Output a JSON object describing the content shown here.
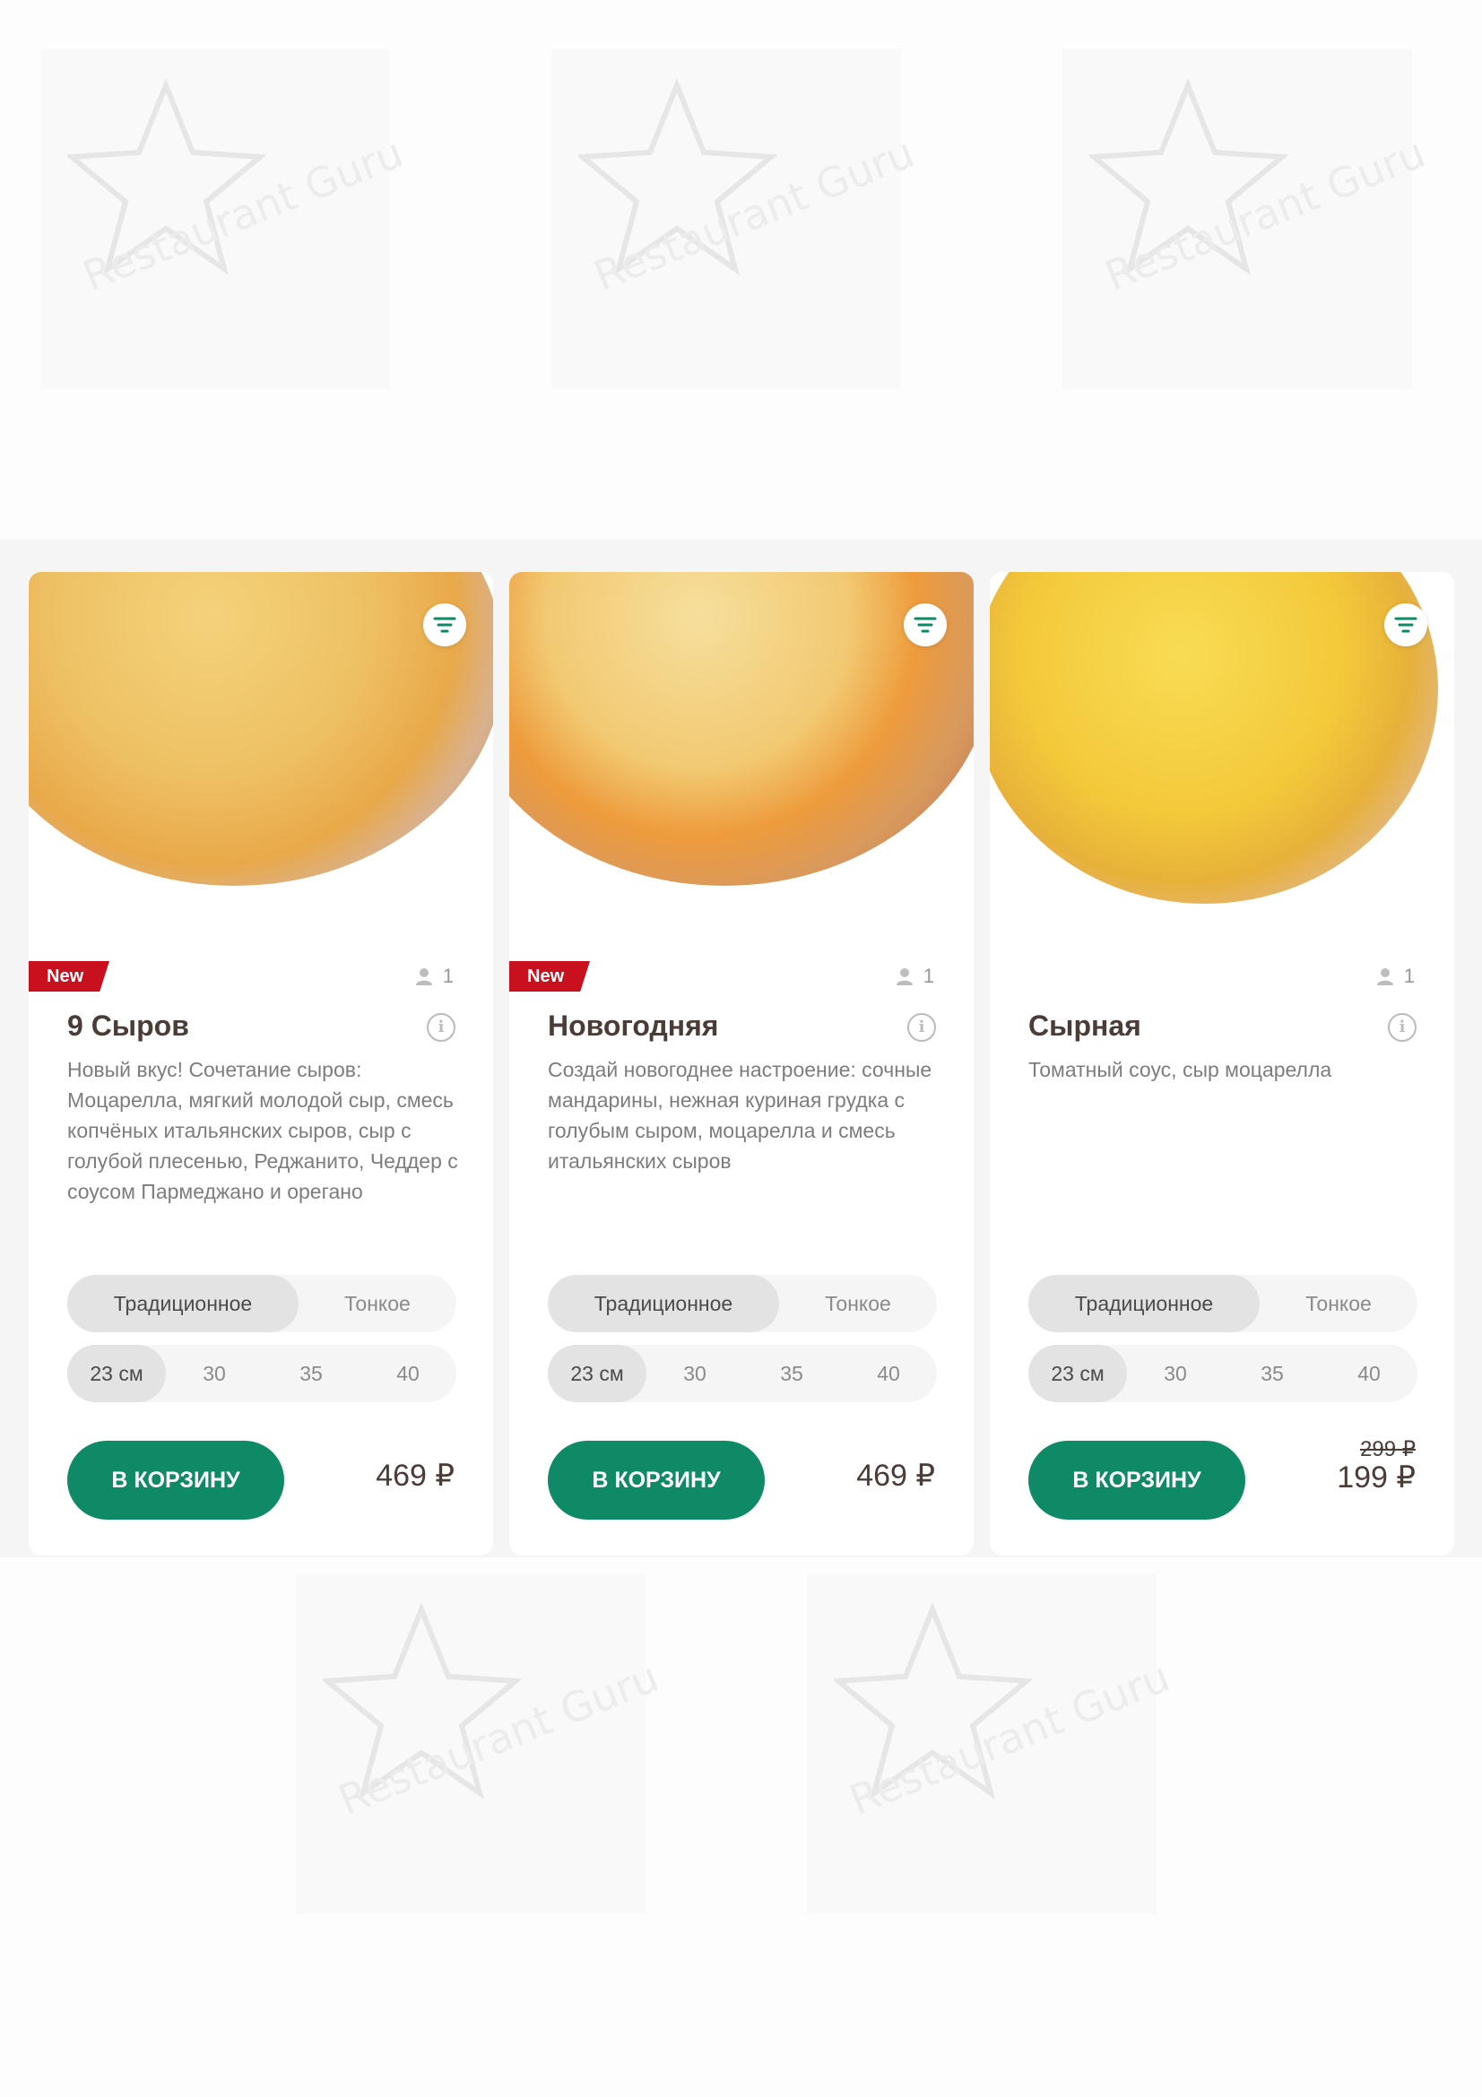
{
  "watermark": {
    "text": "Restaurant Guru"
  },
  "products": [
    {
      "name": "9 Сыров",
      "badge": "New",
      "persons": "1",
      "description": "Новый вкус! Сочетание сыров: Моцарелла, мягкий молодой сыр, смесь копчёных итальянских сыров, сыр с голубой плесенью, Реджанито, Чеддер с соусом Пармеджано и орегано",
      "dough_options": [
        "Традиционное",
        "Тонкое"
      ],
      "dough_selected": "Традиционное",
      "sizes": [
        "23 см",
        "30",
        "35",
        "40"
      ],
      "size_selected": "23 см",
      "button": "В КОРЗИНУ",
      "price": "469 ₽"
    },
    {
      "name": "Новогодняя",
      "badge": "New",
      "persons": "1",
      "description": "Создай новогоднее настроение: сочные мандарины, нежная куриная грудка с голубым сыром, моцарелла и смесь итальянских сыров",
      "dough_options": [
        "Традиционное",
        "Тонкое"
      ],
      "dough_selected": "Традиционное",
      "sizes": [
        "23 см",
        "30",
        "35",
        "40"
      ],
      "size_selected": "23 см",
      "button": "В КОРЗИНУ",
      "price": "469 ₽"
    },
    {
      "name": "Сырная",
      "persons": "1",
      "description": "Томатный соус, сыр моцарелла",
      "dough_options": [
        "Традиционное",
        "Тонкое"
      ],
      "dough_selected": "Традиционное",
      "sizes": [
        "23 см",
        "30",
        "35",
        "40"
      ],
      "size_selected": "23 см",
      "button": "В КОРЗИНУ",
      "price_old": "299 ₽",
      "price": "199 ₽"
    }
  ],
  "colors": {
    "accent": "#0e8a66",
    "badge": "#c8101e",
    "title": "#4a3c37"
  }
}
